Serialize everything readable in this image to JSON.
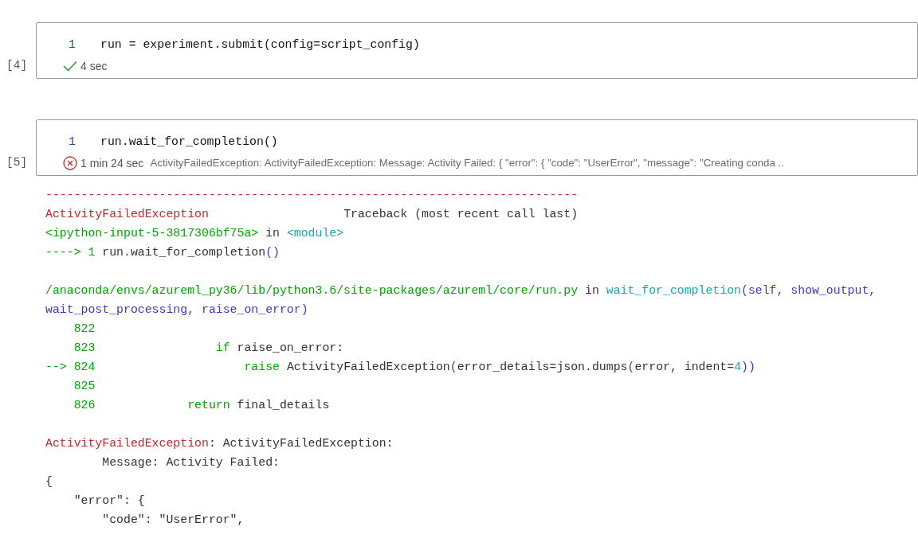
{
  "cells": [
    {
      "prompt": "[4]",
      "lines": [
        {
          "number": "1",
          "code": "run = experiment.submit(config=script_config)"
        }
      ],
      "status": {
        "kind": "success",
        "duration": "4 sec"
      }
    },
    {
      "prompt": "[5]",
      "lines": [
        {
          "number": "1",
          "code": "run.wait_for_completion()"
        }
      ],
      "status": {
        "kind": "error",
        "duration": "1 min 24 sec",
        "message": "ActivityFailedException: ActivityFailedException: Message: Activity Failed: { \"error\": { \"code\": \"UserError\", \"message\": \"Creating conda .."
      },
      "output": [
        {
          "kind": "text",
          "segments": [
            {
              "kind": "error",
              "text": "---------------------------------------------------------------------------"
            }
          ]
        },
        {
          "kind": "text",
          "segments": [
            {
              "kind": "error",
              "text": "ActivityFailedException"
            },
            {
              "kind": "plain",
              "text": "                   Traceback (most recent call last)"
            }
          ]
        },
        {
          "kind": "text",
          "segments": [
            {
              "kind": "green",
              "text": "<ipython-input-5-3817306bf75a>"
            },
            {
              "kind": "plain",
              "text": " in "
            },
            {
              "kind": "cyan",
              "text": "<module>"
            }
          ]
        },
        {
          "kind": "text",
          "segments": [
            {
              "kind": "green",
              "text": "----> 1 "
            },
            {
              "kind": "plain",
              "text": "run"
            },
            {
              "kind": "blue",
              "text": "."
            },
            {
              "kind": "plain",
              "text": "wait_for_completion"
            },
            {
              "kind": "blue",
              "text": "()"
            }
          ]
        },
        {
          "kind": "blank"
        },
        {
          "kind": "text",
          "segments": [
            {
              "kind": "green",
              "text": "/anaconda/envs/azureml_py36/lib/python3.6/site-packages/azureml/core/run.py"
            },
            {
              "kind": "plain",
              "text": " in "
            },
            {
              "kind": "cyan",
              "text": "wait_for_completion"
            },
            {
              "kind": "blue",
              "text": "(self, show_output,"
            }
          ]
        },
        {
          "kind": "text",
          "segments": [
            {
              "kind": "blue",
              "text": "wait_post_processing, raise_on_error)"
            }
          ]
        },
        {
          "kind": "text",
          "segments": [
            {
              "kind": "green",
              "text": "    822"
            }
          ]
        },
        {
          "kind": "text",
          "segments": [
            {
              "kind": "green",
              "text": "    823                 if"
            },
            {
              "kind": "plain",
              "text": " raise_on_error:"
            }
          ]
        },
        {
          "kind": "text",
          "segments": [
            {
              "kind": "green",
              "text": "--> 824                     raise"
            },
            {
              "kind": "plain",
              "text": " ActivityFailedException"
            },
            {
              "kind": "blue",
              "text": "("
            },
            {
              "kind": "plain",
              "text": "error_details=json.dumps"
            },
            {
              "kind": "blue",
              "text": "("
            },
            {
              "kind": "plain",
              "text": "error, indent="
            },
            {
              "kind": "cyan",
              "text": "4"
            },
            {
              "kind": "blue",
              "text": "))"
            }
          ]
        },
        {
          "kind": "text",
          "segments": [
            {
              "kind": "green",
              "text": "    825"
            }
          ]
        },
        {
          "kind": "text",
          "segments": [
            {
              "kind": "green",
              "text": "    826             return"
            },
            {
              "kind": "plain",
              "text": " final_details"
            }
          ]
        },
        {
          "kind": "blank"
        },
        {
          "kind": "text",
          "segments": [
            {
              "kind": "error",
              "text": "ActivityFailedException"
            },
            {
              "kind": "plain",
              "text": ": ActivityFailedException:"
            }
          ]
        },
        {
          "kind": "text",
          "segments": [
            {
              "kind": "plain",
              "text": "        Message: Activity Failed:"
            }
          ]
        },
        {
          "kind": "text",
          "segments": [
            {
              "kind": "plain",
              "text": "{"
            }
          ]
        },
        {
          "kind": "text",
          "segments": [
            {
              "kind": "plain",
              "text": "    \"error\": {"
            }
          ]
        },
        {
          "kind": "text",
          "segments": [
            {
              "kind": "plain",
              "text": "        \"code\": \"UserError\","
            }
          ]
        }
      ]
    }
  ]
}
